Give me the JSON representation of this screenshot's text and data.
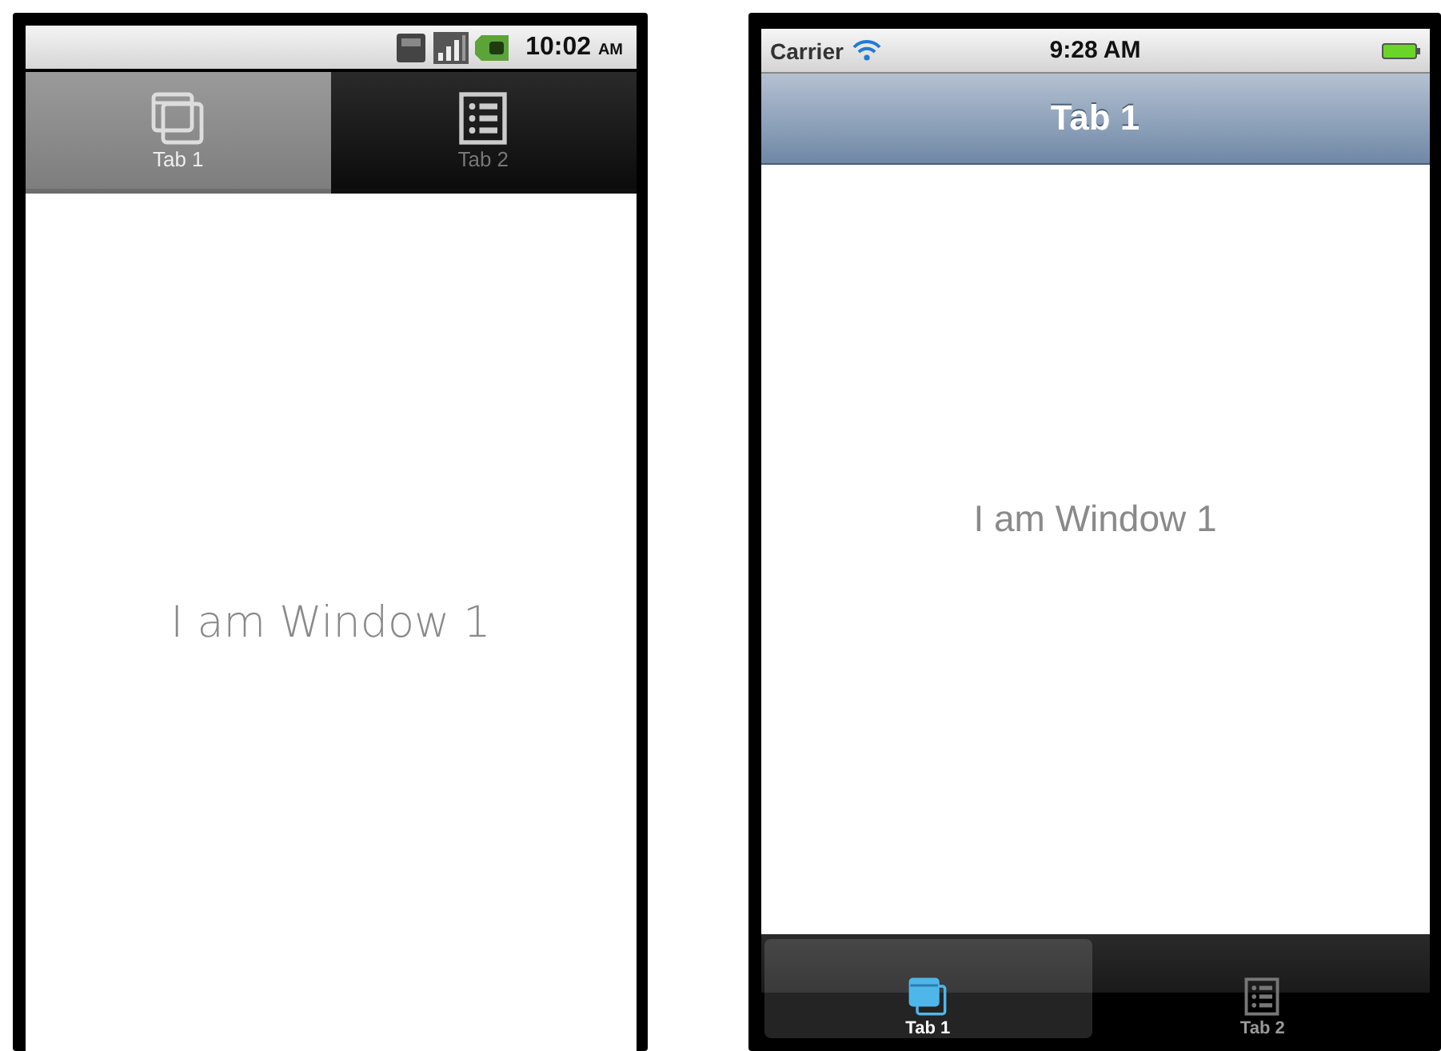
{
  "android": {
    "status_bar": {
      "time": "10:02",
      "time_suffix": "AM"
    },
    "tabs": [
      {
        "label": "Tab 1",
        "kind": "windows",
        "selected": true
      },
      {
        "label": "Tab 2",
        "kind": "list",
        "selected": false
      }
    ],
    "content": "I am Window 1"
  },
  "ios": {
    "status_bar": {
      "carrier": "Carrier",
      "time": "9:28 AM"
    },
    "nav_title": "Tab 1",
    "content": "I am Window 1",
    "tabs": [
      {
        "label": "Tab 1",
        "kind": "windows",
        "selected": true
      },
      {
        "label": "Tab 2",
        "kind": "list",
        "selected": false
      }
    ]
  }
}
